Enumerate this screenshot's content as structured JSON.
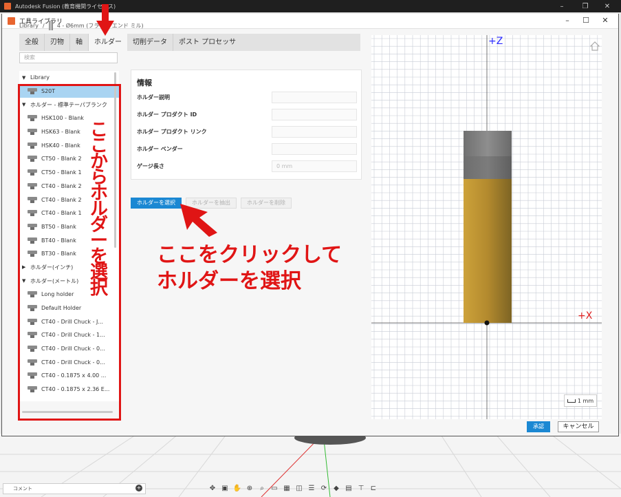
{
  "app": {
    "title": "Autodesk Fusion (教育機関ライセンス)"
  },
  "dialog": {
    "title": "工具ライブラリ"
  },
  "breadcrumb": {
    "root": "Library",
    "separator": "/",
    "tool": "4 - Ø6mm (フラット エンド ミル)"
  },
  "tabs": [
    {
      "label": "全般",
      "active": false
    },
    {
      "label": "刃物",
      "active": false
    },
    {
      "label": "軸",
      "active": false
    },
    {
      "label": "ホルダー",
      "active": true
    },
    {
      "label": "切削データ",
      "active": false
    },
    {
      "label": "ポスト プロセッサ",
      "active": false
    }
  ],
  "search": {
    "placeholder": "検索"
  },
  "tree": {
    "groups": [
      {
        "label": "Library",
        "expanded": true,
        "items": [
          "S20T"
        ]
      },
      {
        "label": "ホルダー - 標準テーパブランク",
        "expanded": true,
        "items": [
          "HSK100 - Blank",
          "HSK63 - Blank",
          "HSK40 - Blank",
          "CT50 - Blank 2",
          "CT50 - Blank 1",
          "CT40 - Blank 2",
          "CT40 - Blank 2",
          "CT40 - Blank 1",
          "BT50 - Blank",
          "BT40 - Blank",
          "BT30 - Blank"
        ]
      },
      {
        "label": "ホルダー(インチ)",
        "expanded": false,
        "items": []
      },
      {
        "label": "ホルダー(メートル)",
        "expanded": true,
        "items": [
          "Long holder",
          "Default Holder",
          "CT40 - Drill Chuck - J...",
          "CT40 - Drill Chuck - 1...",
          "CT40 - Drill Chuck - 0...",
          "CT40 - Drill Chuck - 0...",
          "CT40 - 0.1875 x 4.00 ...",
          "CT40 - 0.1875 x 2.36 E..."
        ]
      }
    ],
    "selected": "S20T"
  },
  "info": {
    "heading": "情報",
    "rows": [
      {
        "label": "ホルダー説明",
        "value": ""
      },
      {
        "label": "ホルダー プロダクト ID",
        "value": ""
      },
      {
        "label": "ホルダー プロダクト リンク",
        "value": ""
      },
      {
        "label": "ホルダー ベンダー",
        "value": ""
      },
      {
        "label": "ゲージ長さ",
        "value": "0 mm"
      }
    ]
  },
  "buttons": {
    "select": "ホルダーを選択",
    "extract": "ホルダーを抽出",
    "delete": "ホルダーを削除"
  },
  "annotations": {
    "vertical": "ここからホルダーを選択",
    "line1": "ここをクリックして",
    "line2": "ホルダーを選択"
  },
  "preview": {
    "axis_z": "+Z",
    "axis_x": "+X",
    "scale": "1 mm"
  },
  "footer": {
    "ok": "承認",
    "cancel": "キャンセル"
  },
  "comment_bar": {
    "label": "コメント"
  },
  "colors": {
    "accent": "#1b88d3",
    "annotation": "#e01515",
    "holder_gold": "#c9a13c",
    "holder_grey": "#7f7f7f"
  }
}
